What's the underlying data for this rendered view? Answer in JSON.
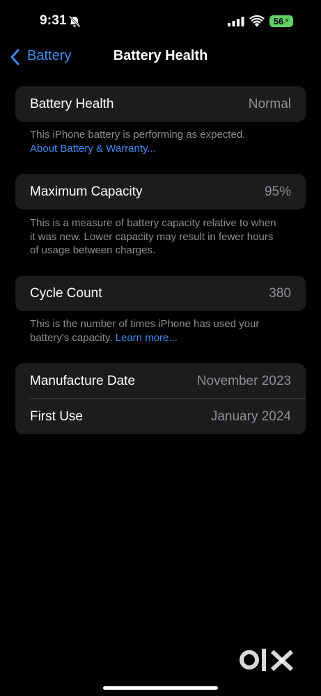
{
  "status_bar": {
    "time": "9:31",
    "battery_percent": "56",
    "icons": [
      "bell-slash-icon",
      "cellular-signal-icon",
      "wifi-icon",
      "battery-charging-icon"
    ],
    "battery_color": "#5fd167"
  },
  "nav": {
    "back_label": "Battery",
    "title": "Battery Health",
    "accent_color": "#3b8cf2"
  },
  "health_card": {
    "label": "Battery Health",
    "value": "Normal",
    "footnote": "This iPhone battery is performing as expected.",
    "link": "About Battery & Warranty..."
  },
  "capacity_card": {
    "label": "Maximum Capacity",
    "value": "95%",
    "footnote": "This is a measure of battery capacity relative to when it was new. Lower capacity may result in fewer hours of usage between charges."
  },
  "cycle_card": {
    "label": "Cycle Count",
    "value": "380",
    "footnote": "This is the number of times iPhone has used your battery's capacity.",
    "link": "Learn more..."
  },
  "dates_card": {
    "rows": [
      {
        "label": "Manufacture Date",
        "value": "November 2023"
      },
      {
        "label": "First Use",
        "value": "January 2024"
      }
    ]
  },
  "watermark": {
    "logo": "olx"
  }
}
